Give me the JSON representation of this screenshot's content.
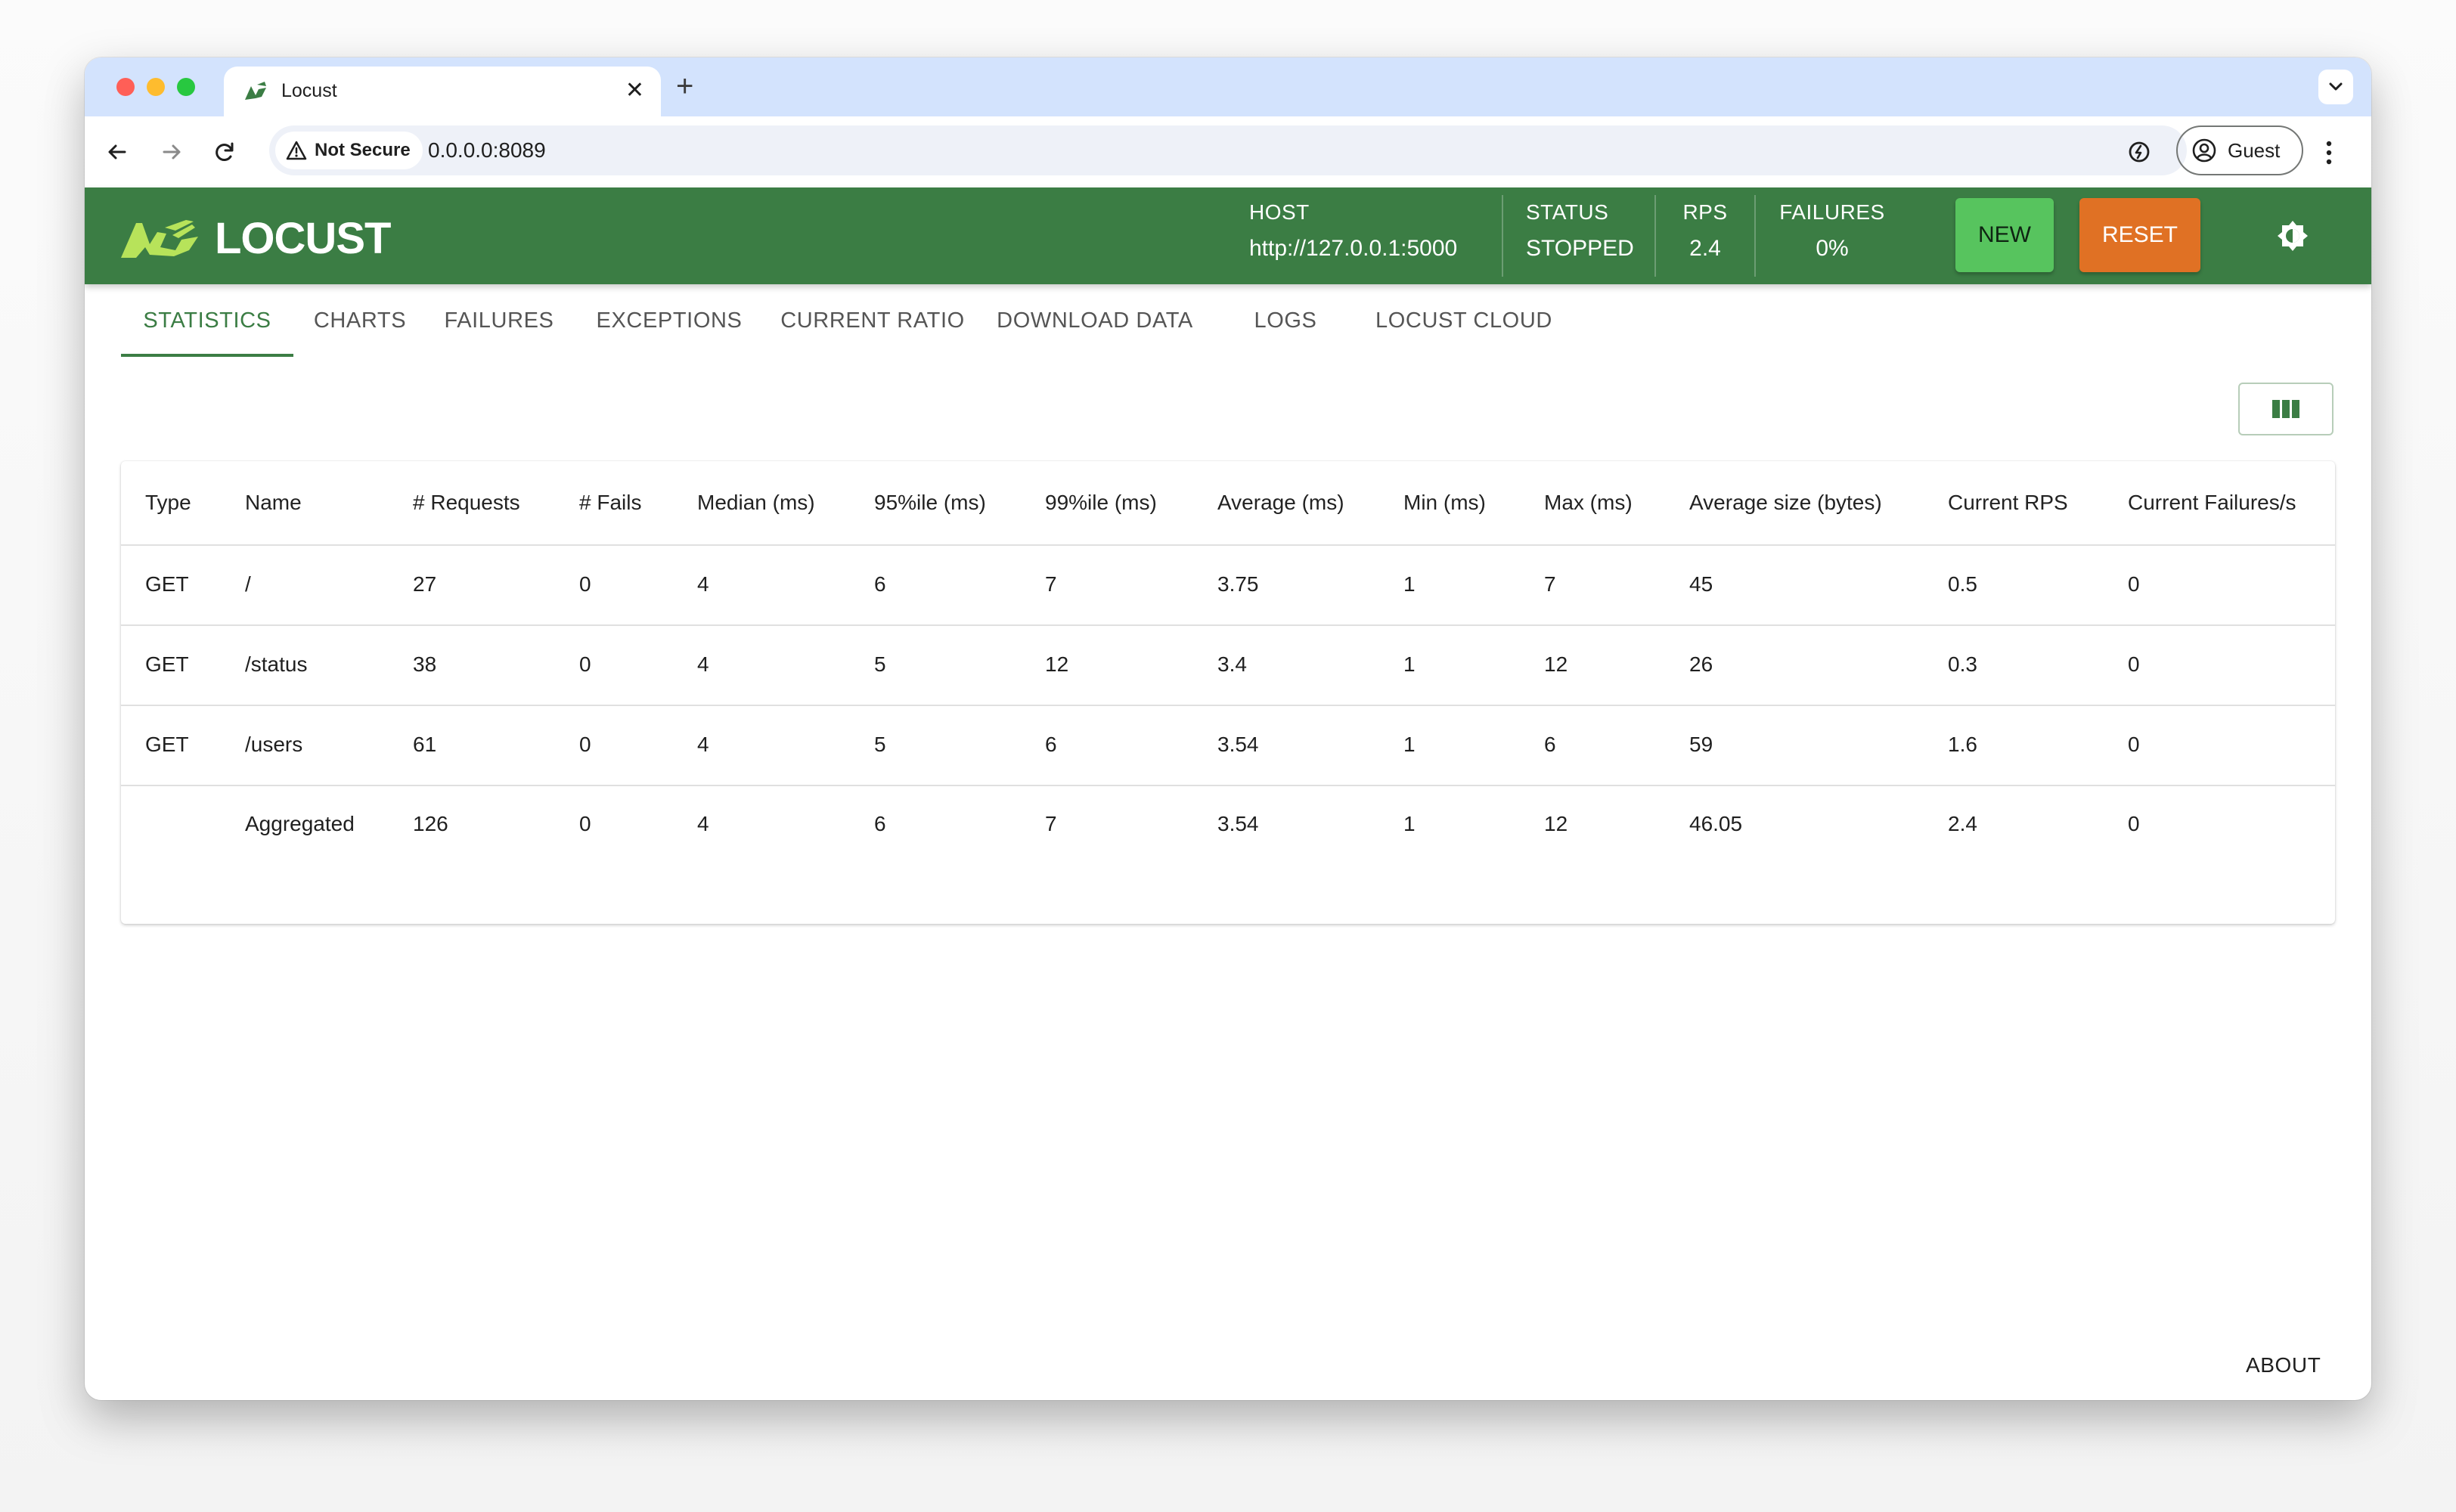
{
  "browser": {
    "tab_title": "Locust",
    "security_label": "Not Secure",
    "url": "0.0.0.0:8089",
    "profile_label": "Guest"
  },
  "app": {
    "logo_text": "LOCUST",
    "host_label": "HOST",
    "host_value": "http://127.0.0.1:5000",
    "status_label": "STATUS",
    "status_value": "STOPPED",
    "rps_label": "RPS",
    "rps_value": "2.4",
    "failures_label": "FAILURES",
    "failures_value": "0%",
    "new_label": "NEW",
    "reset_label": "RESET",
    "accent_color": "#3b7d44",
    "new_button_color": "#57c45e",
    "reset_button_color": "#e07124",
    "icons": {
      "theme": "brightness-icon",
      "columns": "view-column-icon"
    }
  },
  "tabs": [
    {
      "label": "STATISTICS",
      "active": true
    },
    {
      "label": "CHARTS",
      "active": false
    },
    {
      "label": "FAILURES",
      "active": false
    },
    {
      "label": "EXCEPTIONS",
      "active": false
    },
    {
      "label": "CURRENT RATIO",
      "active": false
    },
    {
      "label": "DOWNLOAD DATA",
      "active": false
    },
    {
      "label": "LOGS",
      "active": false
    },
    {
      "label": "LOCUST CLOUD",
      "active": false
    }
  ],
  "table": {
    "headers": [
      "Type",
      "Name",
      "# Requests",
      "# Fails",
      "Median (ms)",
      "95%ile (ms)",
      "99%ile (ms)",
      "Average (ms)",
      "Min (ms)",
      "Max (ms)",
      "Average size (bytes)",
      "Current RPS",
      "Current Failures/s"
    ],
    "rows": [
      [
        "GET",
        "/",
        "27",
        "0",
        "4",
        "6",
        "7",
        "3.75",
        "1",
        "7",
        "45",
        "0.5",
        "0"
      ],
      [
        "GET",
        "/status",
        "38",
        "0",
        "4",
        "5",
        "12",
        "3.4",
        "1",
        "12",
        "26",
        "0.3",
        "0"
      ],
      [
        "GET",
        "/users",
        "61",
        "0",
        "4",
        "5",
        "6",
        "3.54",
        "1",
        "6",
        "59",
        "1.6",
        "0"
      ],
      [
        "",
        "Aggregated",
        "126",
        "0",
        "4",
        "6",
        "7",
        "3.54",
        "1",
        "12",
        "46.05",
        "2.4",
        "0"
      ]
    ]
  },
  "footer": {
    "about_label": "ABOUT"
  }
}
